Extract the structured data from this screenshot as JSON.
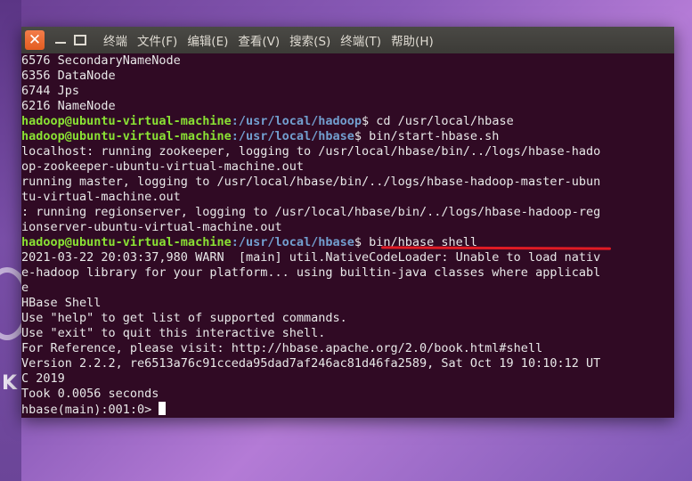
{
  "window": {
    "menu": [
      "终端",
      "文件(F)",
      "编辑(E)",
      "查看(V)",
      "搜索(S)",
      "终端(T)",
      "帮助(H)"
    ],
    "close_icon": "✕"
  },
  "desktop": {
    "letter": "K"
  },
  "terminal": {
    "prompt_user": "hadoop@ubuntu-virtual-machine",
    "lines": [
      {
        "text": "6576 SecondaryNameNode"
      },
      {
        "text": "6356 DataNode"
      },
      {
        "text": "6744 Jps"
      },
      {
        "text": "6216 NameNode"
      },
      {
        "path": ":/usr/local/hadoop",
        "cmd": "$ cd /usr/local/hbase"
      },
      {
        "path": ":/usr/local/hbase",
        "cmd": "$ bin/start-hbase.sh"
      },
      {
        "text": "localhost: running zookeeper, logging to /usr/local/hbase/bin/../logs/hbase-hado"
      },
      {
        "text": "op-zookeeper-ubuntu-virtual-machine.out"
      },
      {
        "text": "running master, logging to /usr/local/hbase/bin/../logs/hbase-hadoop-master-ubun"
      },
      {
        "text": "tu-virtual-machine.out"
      },
      {
        "text": ": running regionserver, logging to /usr/local/hbase/bin/../logs/hbase-hadoop-reg"
      },
      {
        "text": "ionserver-ubuntu-virtual-machine.out"
      },
      {
        "path": ":/usr/local/hbase",
        "cmd": "$ bin/hbase shell"
      },
      {
        "text": "2021-03-22 20:03:37,980 WARN  [main] util.NativeCodeLoader: Unable to load nativ"
      },
      {
        "text": "e-hadoop library for your platform... using builtin-java classes where applicabl"
      },
      {
        "text": "e"
      },
      {
        "text": "HBase Shell"
      },
      {
        "text": "Use \"help\" to get list of supported commands."
      },
      {
        "text": "Use \"exit\" to quit this interactive shell."
      },
      {
        "text": "For Reference, please visit: http://hbase.apache.org/2.0/book.html#shell"
      },
      {
        "text": "Version 2.2.2, re6513a76c91cceda95dad7af246ac81d46fa2589, Sat Oct 19 10:10:12 UT"
      },
      {
        "text": "C 2019"
      },
      {
        "text": "Took 0.0056 seconds"
      },
      {
        "text": "hbase(main):001:0> ",
        "cursor": true
      }
    ]
  }
}
